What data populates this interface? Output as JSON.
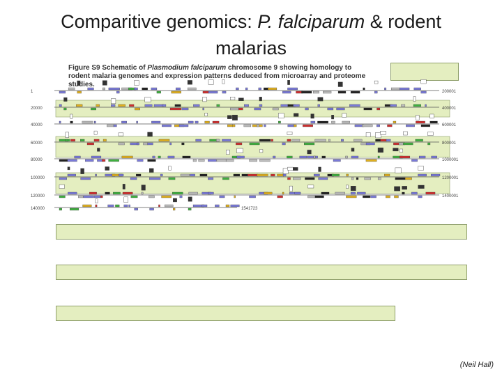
{
  "slide": {
    "title_line1_prefix": "Comparitive genomics: ",
    "title_species": "P. falciparum",
    "title_line1_suffix": " & rodent",
    "title_line2": "malarias",
    "credit": "(Neil Hall)"
  },
  "figure": {
    "caption_prefix": "Figure S9 Schematic of ",
    "caption_species": "Plasmodium falciparum",
    "caption_suffix": " chromosome 9 showing homology to rodent malaria genomes and expression patterns deduced from microarray and proteome studies.",
    "ruler_left_labels": [
      "1",
      "20000",
      "40000",
      "60000",
      "80000",
      "100000",
      "120000",
      "140000"
    ],
    "ruler_right_labels": [
      "200001",
      "400001",
      "600001",
      "800001",
      "1000001",
      "1200001",
      "1400001",
      "1541723"
    ]
  },
  "colors": {
    "highlight_band": "#e4eec0",
    "highlight_border": "#8e9e6a",
    "gene_blue": "#7a7ad8",
    "gene_red": "#d03030",
    "gene_yellow": "#e0b020",
    "gene_green": "#40b040",
    "gene_dark": "#222222"
  }
}
